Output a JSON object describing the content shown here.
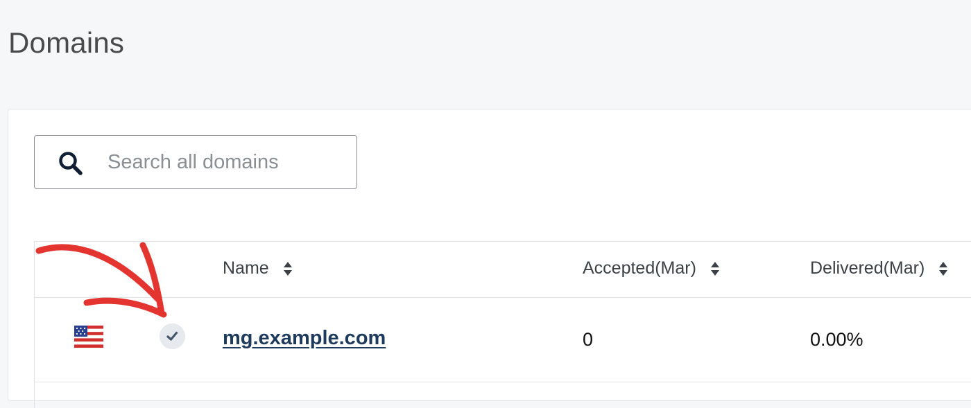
{
  "page": {
    "title": "Domains"
  },
  "search": {
    "placeholder": "Search all domains",
    "icon": "search-icon"
  },
  "table": {
    "columns": [
      {
        "label": "Name",
        "sortable": true
      },
      {
        "label": "Accepted(Mar)",
        "sortable": true
      },
      {
        "label": "Delivered(Mar)",
        "sortable": true
      }
    ],
    "rows": [
      {
        "flag_icon": "us-flag-icon",
        "status_icon": "verified-check-icon",
        "name": "mg.example.com",
        "accepted": "0",
        "delivered": "0.00%"
      }
    ]
  },
  "colors": {
    "background": "#f6f7f9",
    "panel": "#ffffff",
    "link": "#1e3a5c",
    "annotation": "#e3342f"
  }
}
